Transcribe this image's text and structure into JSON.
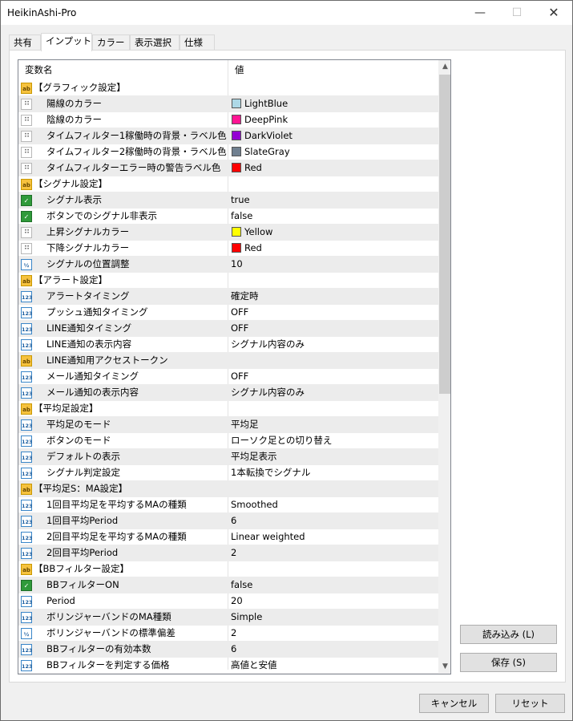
{
  "window": {
    "title": "HeikinAshi-Pro",
    "minimize": "—",
    "maximize": "☐",
    "close": "✕"
  },
  "tabs": [
    {
      "label": "共有"
    },
    {
      "label": "インプット"
    },
    {
      "label": "カラー"
    },
    {
      "label": "表示選択"
    },
    {
      "label": "仕様"
    }
  ],
  "grid": {
    "headers": {
      "name": "変数名",
      "value": "値"
    },
    "rows": [
      {
        "type": "group",
        "icon": "ab",
        "name": "【グラフィック設定】",
        "value": ""
      },
      {
        "type": "color",
        "icon": "color",
        "name": "陽線のカラー",
        "value": "LightBlue",
        "color": "#ADD8E6"
      },
      {
        "type": "color",
        "icon": "color",
        "name": "陰線のカラー",
        "value": "DeepPink",
        "color": "#FF1493"
      },
      {
        "type": "color",
        "icon": "color",
        "name": "タイムフィルター1稼働時の背景・ラベル色",
        "value": "DarkViolet",
        "color": "#9400D3"
      },
      {
        "type": "color",
        "icon": "color",
        "name": "タイムフィルター2稼働時の背景・ラベル色",
        "value": "SlateGray",
        "color": "#708090"
      },
      {
        "type": "color",
        "icon": "color",
        "name": "タイムフィルターエラー時の警告ラベル色",
        "value": "Red",
        "color": "#FF0000"
      },
      {
        "type": "group",
        "icon": "ab",
        "name": "【シグナル設定】",
        "value": ""
      },
      {
        "type": "item",
        "icon": "bool",
        "name": "シグナル表示",
        "value": "true"
      },
      {
        "type": "item",
        "icon": "bool",
        "name": "ボタンでのシグナル非表示",
        "value": "false"
      },
      {
        "type": "color",
        "icon": "color",
        "name": "上昇シグナルカラー",
        "value": "Yellow",
        "color": "#FFFF00"
      },
      {
        "type": "color",
        "icon": "color",
        "name": "下降シグナルカラー",
        "value": "Red",
        "color": "#FF0000"
      },
      {
        "type": "item",
        "icon": "frac",
        "name": "シグナルの位置調整",
        "value": "10"
      },
      {
        "type": "group",
        "icon": "ab",
        "name": "【アラート設定】",
        "value": ""
      },
      {
        "type": "item",
        "icon": "num",
        "name": "アラートタイミング",
        "value": "確定時"
      },
      {
        "type": "item",
        "icon": "num",
        "name": "プッシュ通知タイミング",
        "value": "OFF"
      },
      {
        "type": "item",
        "icon": "num",
        "name": "LINE通知タイミング",
        "value": "OFF"
      },
      {
        "type": "item",
        "icon": "num",
        "name": "LINE通知の表示内容",
        "value": "シグナル内容のみ"
      },
      {
        "type": "item",
        "icon": "ab",
        "name": "LINE通知用アクセストークン",
        "value": ""
      },
      {
        "type": "item",
        "icon": "num",
        "name": "メール通知タイミング",
        "value": "OFF"
      },
      {
        "type": "item",
        "icon": "num",
        "name": "メール通知の表示内容",
        "value": "シグナル内容のみ"
      },
      {
        "type": "group",
        "icon": "ab",
        "name": "【平均足設定】",
        "value": ""
      },
      {
        "type": "item",
        "icon": "num",
        "name": "平均足のモード",
        "value": "平均足"
      },
      {
        "type": "item",
        "icon": "num",
        "name": "ボタンのモード",
        "value": "ローソク足との切り替え"
      },
      {
        "type": "item",
        "icon": "num",
        "name": "デフォルトの表示",
        "value": "平均足表示"
      },
      {
        "type": "item",
        "icon": "num",
        "name": "シグナル判定設定",
        "value": "1本転換でシグナル"
      },
      {
        "type": "group",
        "icon": "ab",
        "name": "【平均足S：MA設定】",
        "value": ""
      },
      {
        "type": "item",
        "icon": "num",
        "name": "1回目平均足を平均するMAの種類",
        "value": "Smoothed"
      },
      {
        "type": "item",
        "icon": "num",
        "name": "1回目平均Period",
        "value": "6"
      },
      {
        "type": "item",
        "icon": "num",
        "name": "2回目平均足を平均するMAの種類",
        "value": "Linear weighted"
      },
      {
        "type": "item",
        "icon": "num",
        "name": "2回目平均Period",
        "value": "2"
      },
      {
        "type": "group",
        "icon": "ab",
        "name": "【BBフィルター設定】",
        "value": ""
      },
      {
        "type": "item",
        "icon": "bool",
        "name": "BBフィルターON",
        "value": "false"
      },
      {
        "type": "item",
        "icon": "num",
        "name": "Period",
        "value": "20"
      },
      {
        "type": "item",
        "icon": "num",
        "name": "ボリンジャーバンドのMA種類",
        "value": "Simple"
      },
      {
        "type": "item",
        "icon": "frac",
        "name": "ボリンジャーバンドの標準偏差",
        "value": "2"
      },
      {
        "type": "item",
        "icon": "num",
        "name": "BBフィルターの有効本数",
        "value": "6"
      },
      {
        "type": "item",
        "icon": "num",
        "name": "BBフィルターを判定する価格",
        "value": "高値と安値"
      }
    ]
  },
  "buttons": {
    "load": "読み込み (L)",
    "save": "保存 (S)",
    "cancel": "キャンセル",
    "reset": "リセット"
  },
  "icons": {
    "ab": "ab-string-icon",
    "color": "color-icon",
    "num": "integer-icon",
    "bool": "boolean-icon",
    "frac": "double-icon"
  }
}
